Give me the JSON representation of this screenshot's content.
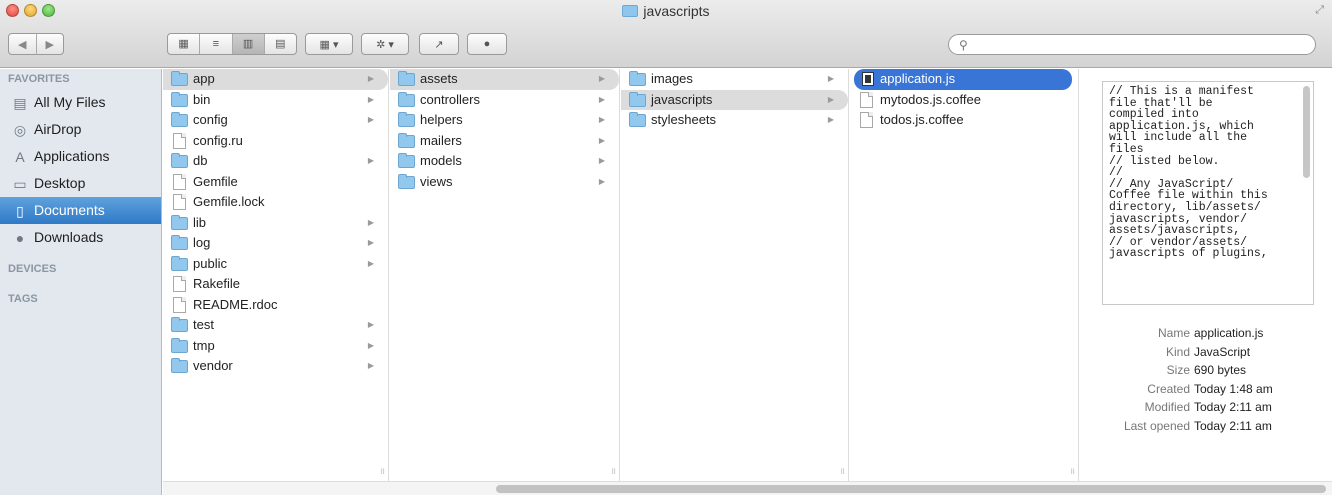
{
  "window": {
    "title": "javascripts",
    "search_placeholder": ""
  },
  "toolbar": {
    "back_label": "◀",
    "forward_label": "▶",
    "view_icons": [
      "▦",
      "≡",
      "▥",
      "▤"
    ],
    "arrange_label": "▦ ▾",
    "action_label": "✲ ▾",
    "share_label": "↗",
    "label_label": "●"
  },
  "sidebar": {
    "favorites_header": "FAVORITES",
    "items": [
      {
        "label": "All My Files",
        "icon": "all-files-icon",
        "glyph": "▤"
      },
      {
        "label": "AirDrop",
        "icon": "airdrop-icon",
        "glyph": "◎"
      },
      {
        "label": "Applications",
        "icon": "applications-icon",
        "glyph": "A"
      },
      {
        "label": "Desktop",
        "icon": "desktop-icon",
        "glyph": "▭"
      },
      {
        "label": "Documents",
        "icon": "documents-icon",
        "glyph": "▯"
      },
      {
        "label": "Downloads",
        "icon": "downloads-icon",
        "glyph": "●"
      }
    ],
    "devices_header": "DEVICES",
    "tags_header": "TAGS"
  },
  "columns": {
    "col1": [
      {
        "name": "app",
        "kind": "folder"
      },
      {
        "name": "bin",
        "kind": "folder"
      },
      {
        "name": "config",
        "kind": "folder"
      },
      {
        "name": "config.ru",
        "kind": "file"
      },
      {
        "name": "db",
        "kind": "folder"
      },
      {
        "name": "Gemfile",
        "kind": "file"
      },
      {
        "name": "Gemfile.lock",
        "kind": "file"
      },
      {
        "name": "lib",
        "kind": "folder"
      },
      {
        "name": "log",
        "kind": "folder"
      },
      {
        "name": "public",
        "kind": "folder"
      },
      {
        "name": "Rakefile",
        "kind": "file"
      },
      {
        "name": "README.rdoc",
        "kind": "file"
      },
      {
        "name": "test",
        "kind": "folder"
      },
      {
        "name": "tmp",
        "kind": "folder"
      },
      {
        "name": "vendor",
        "kind": "folder"
      }
    ],
    "col2": [
      {
        "name": "assets",
        "kind": "folder"
      },
      {
        "name": "controllers",
        "kind": "folder"
      },
      {
        "name": "helpers",
        "kind": "folder"
      },
      {
        "name": "mailers",
        "kind": "folder"
      },
      {
        "name": "models",
        "kind": "folder"
      },
      {
        "name": "views",
        "kind": "folder"
      }
    ],
    "col3": [
      {
        "name": "images",
        "kind": "folder"
      },
      {
        "name": "javascripts",
        "kind": "folder"
      },
      {
        "name": "stylesheets",
        "kind": "folder"
      }
    ],
    "col4": [
      {
        "name": "application.js",
        "kind": "js"
      },
      {
        "name": "mytodos.js.coffee",
        "kind": "file"
      },
      {
        "name": "todos.js.coffee",
        "kind": "file"
      }
    ]
  },
  "preview": {
    "code": "// This is a manifest\nfile that'll be\ncompiled into\napplication.js, which\nwill include all the\nfiles\n// listed below.\n//\n// Any JavaScript/\nCoffee file within this\ndirectory, lib/assets/\njavascripts, vendor/\nassets/javascripts,\n// or vendor/assets/\njavascripts of plugins,",
    "info": [
      {
        "key": "Name",
        "value": "application.js"
      },
      {
        "key": "Kind",
        "value": "JavaScript"
      },
      {
        "key": "Size",
        "value": "690 bytes"
      },
      {
        "key": "Created",
        "value": "Today 1:48 am"
      },
      {
        "key": "Modified",
        "value": "Today 2:11 am"
      },
      {
        "key": "Last opened",
        "value": "Today 2:11 am"
      }
    ]
  }
}
